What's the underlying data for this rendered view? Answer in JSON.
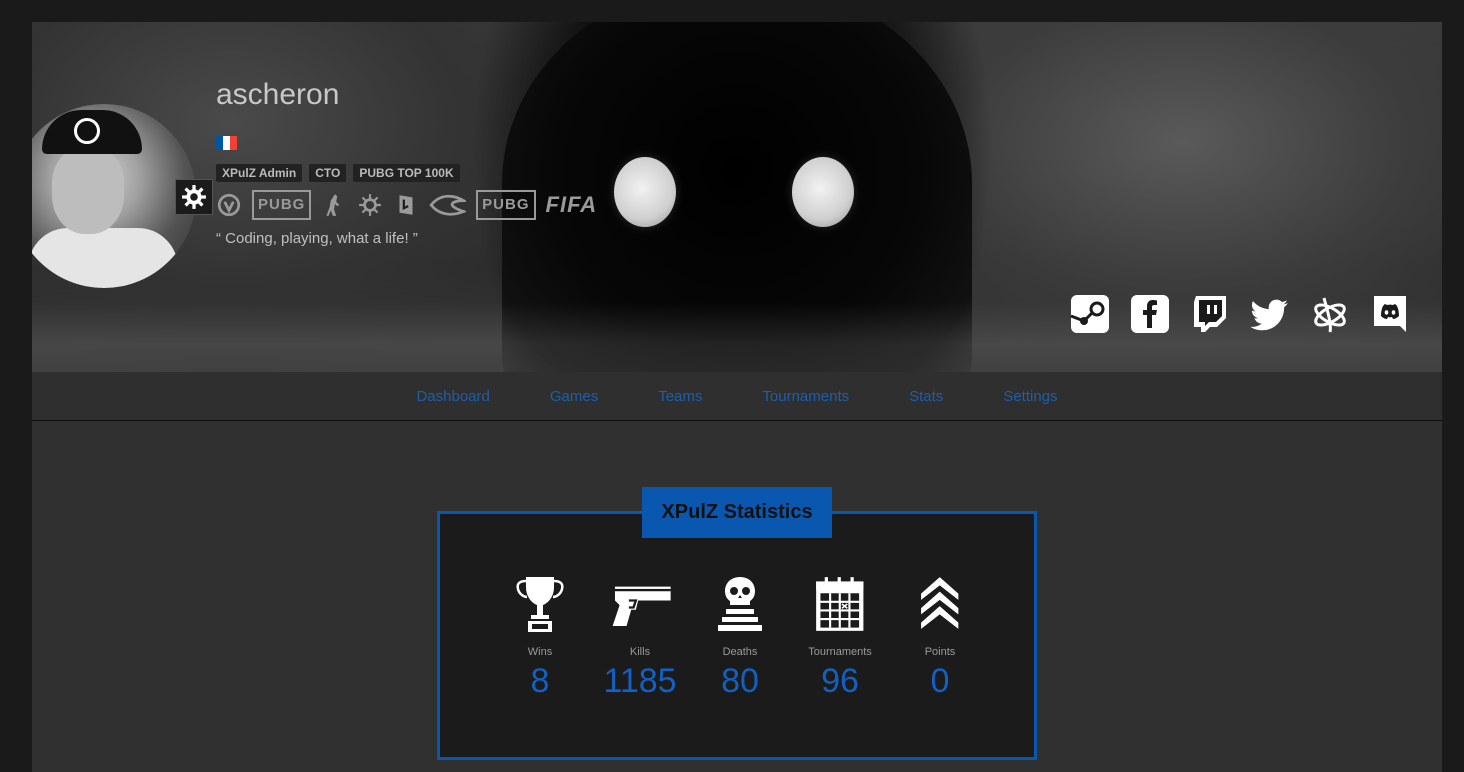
{
  "profile": {
    "username": "ascheron",
    "flag_colors": [
      "#0055a4",
      "#ffffff",
      "#ef4135"
    ],
    "badges": [
      "XPulZ Admin",
      "CTO",
      "PUBG TOP 100K"
    ],
    "quote": "“ Coding, playing, what a life! ”",
    "games": [
      "overwatch-icon",
      "PUBG",
      "counter-strike-icon",
      "league-icon",
      "dota-icon",
      "rocket-league-icon",
      "PUBG",
      "FIFA"
    ]
  },
  "socials": [
    "steam-icon",
    "facebook-icon",
    "twitch-icon",
    "twitter-icon",
    "battlenet-icon",
    "discord-icon"
  ],
  "nav": {
    "items": [
      "Dashboard",
      "Games",
      "Teams",
      "Tournaments",
      "Stats",
      "Settings"
    ]
  },
  "stats": {
    "title": "XPulZ Statistics",
    "items": [
      {
        "label": "Wins",
        "value": "8",
        "icon": "trophy-icon"
      },
      {
        "label": "Kills",
        "value": "1185",
        "icon": "pistol-icon"
      },
      {
        "label": "Deaths",
        "value": "80",
        "icon": "skull-icon"
      },
      {
        "label": "Tournaments",
        "value": "96",
        "icon": "calendar-icon"
      },
      {
        "label": "Points",
        "value": "0",
        "icon": "chevrons-icon"
      }
    ]
  },
  "colors": {
    "accent": "#0a57b0",
    "nav_link": "#1e5ea8",
    "stat_value": "#1260c2"
  }
}
